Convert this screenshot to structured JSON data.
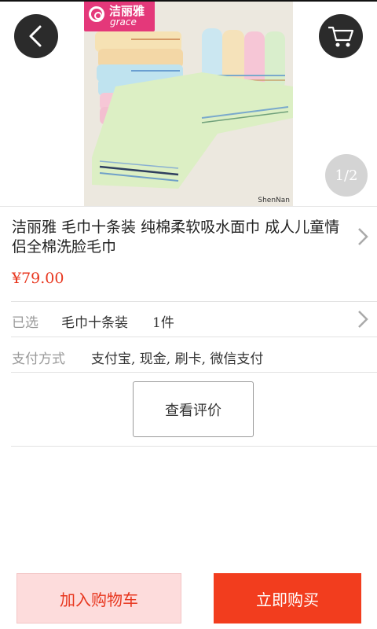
{
  "hero": {
    "logo_cn": "洁丽雅",
    "logo_en": "grace",
    "watermark": "ShenNan",
    "page_indicator": "1/2",
    "icons": {
      "back": "chevron-left-icon",
      "cart": "shopping-cart-icon"
    }
  },
  "product": {
    "title": "洁丽雅 毛巾十条装 纯棉柔软吸水面巾 成人儿童情侣全棉洗脸毛巾",
    "price": "¥79.00"
  },
  "selected": {
    "label": "已选",
    "value": "毛巾十条装",
    "qty": "1件"
  },
  "payment": {
    "label": "支付方式",
    "value": "支付宝, 现金, 刷卡, 微信支付"
  },
  "review_button": "查看评价",
  "actions": {
    "add_to_cart": "加入购物车",
    "buy_now": "立即购买"
  },
  "colors": {
    "accent": "#f23d1e",
    "price": "#e8361e",
    "cart_bg": "#fddcdc",
    "logo": "#e4387a"
  }
}
